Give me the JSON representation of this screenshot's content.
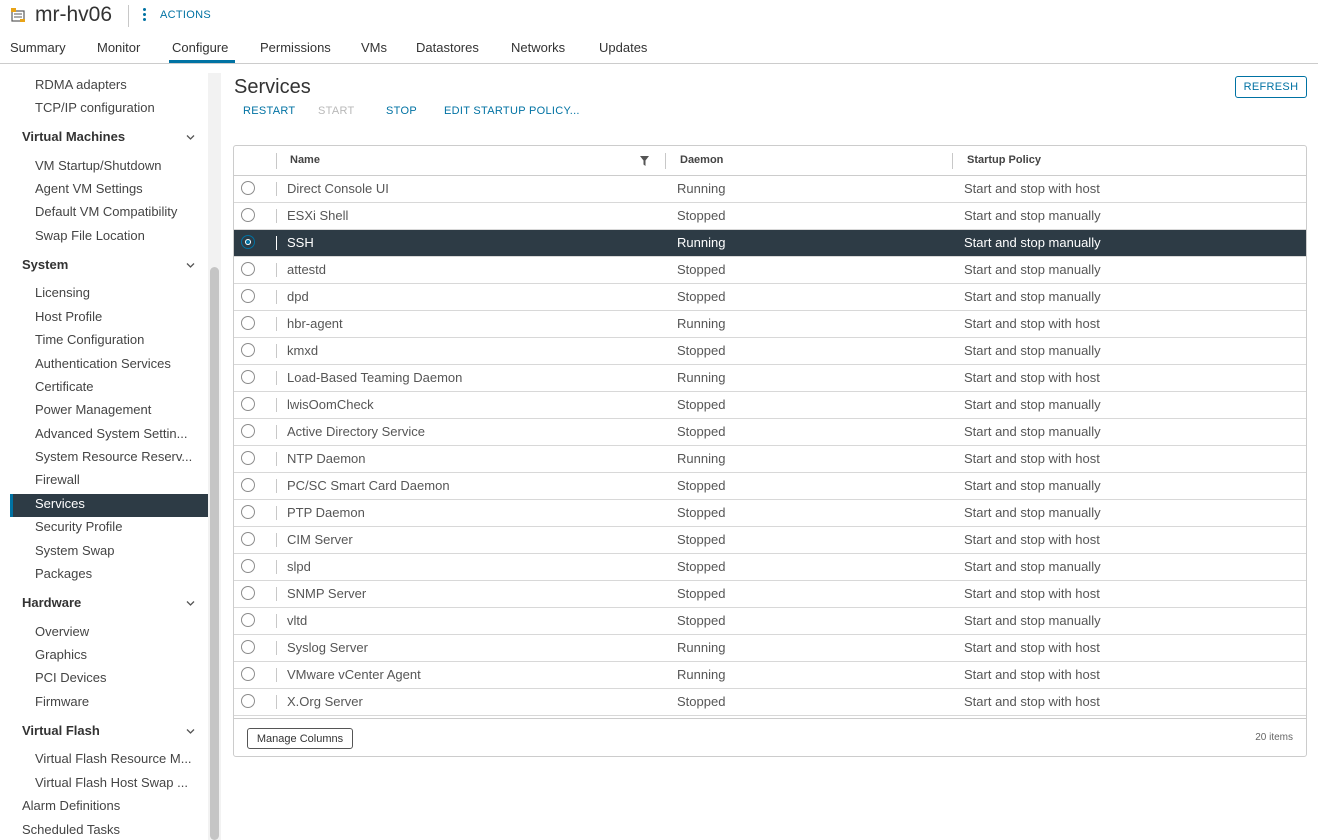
{
  "header": {
    "host_name": "mr-hv06",
    "actions_label": "ACTIONS"
  },
  "tabs": [
    {
      "label": "Summary"
    },
    {
      "label": "Monitor"
    },
    {
      "label": "Configure",
      "active": true
    },
    {
      "label": "Permissions"
    },
    {
      "label": "VMs"
    },
    {
      "label": "Datastores"
    },
    {
      "label": "Networks"
    },
    {
      "label": "Updates"
    }
  ],
  "sidebar": {
    "items_pre": [
      "RDMA adapters",
      "TCP/IP configuration"
    ],
    "group_vm": "Virtual Machines",
    "items_vm": [
      "VM Startup/Shutdown",
      "Agent VM Settings",
      "Default VM Compatibility",
      "Swap File Location"
    ],
    "group_system": "System",
    "items_system": [
      "Licensing",
      "Host Profile",
      "Time Configuration",
      "Authentication Services",
      "Certificate",
      "Power Management",
      "Advanced System Settin...",
      "System Resource Reserv...",
      "Firewall",
      "Services",
      "Security Profile",
      "System Swap",
      "Packages"
    ],
    "group_hardware": "Hardware",
    "items_hardware": [
      "Overview",
      "Graphics",
      "PCI Devices",
      "Firmware"
    ],
    "group_flash": "Virtual Flash",
    "items_flash": [
      "Virtual Flash Resource M...",
      "Virtual Flash Host Swap ..."
    ],
    "items_post": [
      "Alarm Definitions",
      "Scheduled Tasks"
    ],
    "selected": "Services"
  },
  "main": {
    "title": "Services",
    "refresh_label": "REFRESH",
    "toolbar": {
      "restart": "RESTART",
      "start": "START",
      "stop": "STOP",
      "edit_policy": "EDIT STARTUP POLICY..."
    },
    "columns": {
      "name": "Name",
      "daemon": "Daemon",
      "policy": "Startup Policy"
    },
    "rows": [
      {
        "name": "Direct Console UI",
        "daemon": "Running",
        "policy": "Start and stop with host"
      },
      {
        "name": "ESXi Shell",
        "daemon": "Stopped",
        "policy": "Start and stop manually"
      },
      {
        "name": "SSH",
        "daemon": "Running",
        "policy": "Start and stop manually",
        "selected": true
      },
      {
        "name": "attestd",
        "daemon": "Stopped",
        "policy": "Start and stop manually"
      },
      {
        "name": "dpd",
        "daemon": "Stopped",
        "policy": "Start and stop manually"
      },
      {
        "name": "hbr-agent",
        "daemon": "Running",
        "policy": "Start and stop with host"
      },
      {
        "name": "kmxd",
        "daemon": "Stopped",
        "policy": "Start and stop manually"
      },
      {
        "name": "Load-Based Teaming Daemon",
        "daemon": "Running",
        "policy": "Start and stop with host"
      },
      {
        "name": "lwisOomCheck",
        "daemon": "Stopped",
        "policy": "Start and stop manually"
      },
      {
        "name": "Active Directory Service",
        "daemon": "Stopped",
        "policy": "Start and stop manually"
      },
      {
        "name": "NTP Daemon",
        "daemon": "Running",
        "policy": "Start and stop with host"
      },
      {
        "name": "PC/SC Smart Card Daemon",
        "daemon": "Stopped",
        "policy": "Start and stop manually"
      },
      {
        "name": "PTP Daemon",
        "daemon": "Stopped",
        "policy": "Start and stop manually"
      },
      {
        "name": "CIM Server",
        "daemon": "Stopped",
        "policy": "Start and stop with host"
      },
      {
        "name": "slpd",
        "daemon": "Stopped",
        "policy": "Start and stop manually"
      },
      {
        "name": "SNMP Server",
        "daemon": "Stopped",
        "policy": "Start and stop with host"
      },
      {
        "name": "vltd",
        "daemon": "Stopped",
        "policy": "Start and stop manually"
      },
      {
        "name": "Syslog Server",
        "daemon": "Running",
        "policy": "Start and stop with host"
      },
      {
        "name": "VMware vCenter Agent",
        "daemon": "Running",
        "policy": "Start and stop with host"
      },
      {
        "name": "X.Org Server",
        "daemon": "Stopped",
        "policy": "Start and stop with host"
      }
    ],
    "footer": {
      "manage_columns": "Manage Columns",
      "item_count": "20 items"
    }
  },
  "colors": {
    "accent": "#0072a3",
    "selected_bg": "#2d3b45"
  },
  "icons": {
    "host": "host-icon",
    "actions": "kebab-menu-icon",
    "group_toggle": "chevron-down-icon",
    "filter": "filter-icon"
  }
}
